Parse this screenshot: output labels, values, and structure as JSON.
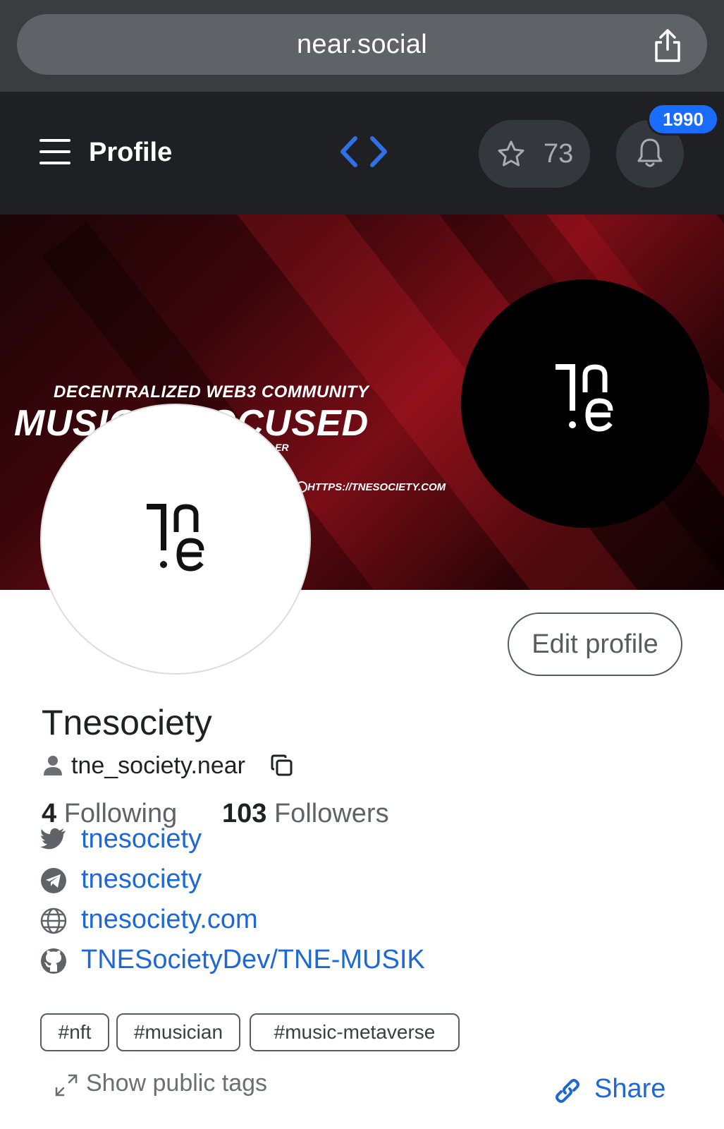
{
  "browser": {
    "url": "near.social",
    "share_icon": "share-icon"
  },
  "nav": {
    "title": "Profile",
    "star_count": "73",
    "notification_count": "1990",
    "accent": "#2f6fe8"
  },
  "banner": {
    "subtitle": "DECENTRALIZED WEB3 COMMUNITY",
    "headline": "MUSIC & FOCUSED",
    "small_text": "ER",
    "url_text": "HTTPS://TNESOCIETY.COM"
  },
  "profile": {
    "edit_label": "Edit profile",
    "name": "Tnesociety",
    "account_id": "tne_society.near",
    "following_count": "4",
    "following_label": "Following",
    "followers_count": "103",
    "followers_label": "Followers"
  },
  "links": [
    {
      "icon": "twitter-icon",
      "text": "tnesociety"
    },
    {
      "icon": "telegram-icon",
      "text": "tnesociety"
    },
    {
      "icon": "globe-icon",
      "text": "tnesociety.com"
    },
    {
      "icon": "github-icon",
      "text": "TNESocietyDev/TNE-MUSIK"
    }
  ],
  "tags": [
    "#nft",
    "#musician",
    "#music-metaverse"
  ],
  "show_tags_label": "Show public tags",
  "share_label": "Share",
  "colors": {
    "link": "#1d68d6",
    "badge": "#1a6cff",
    "nav_bg": "#1f2023"
  }
}
